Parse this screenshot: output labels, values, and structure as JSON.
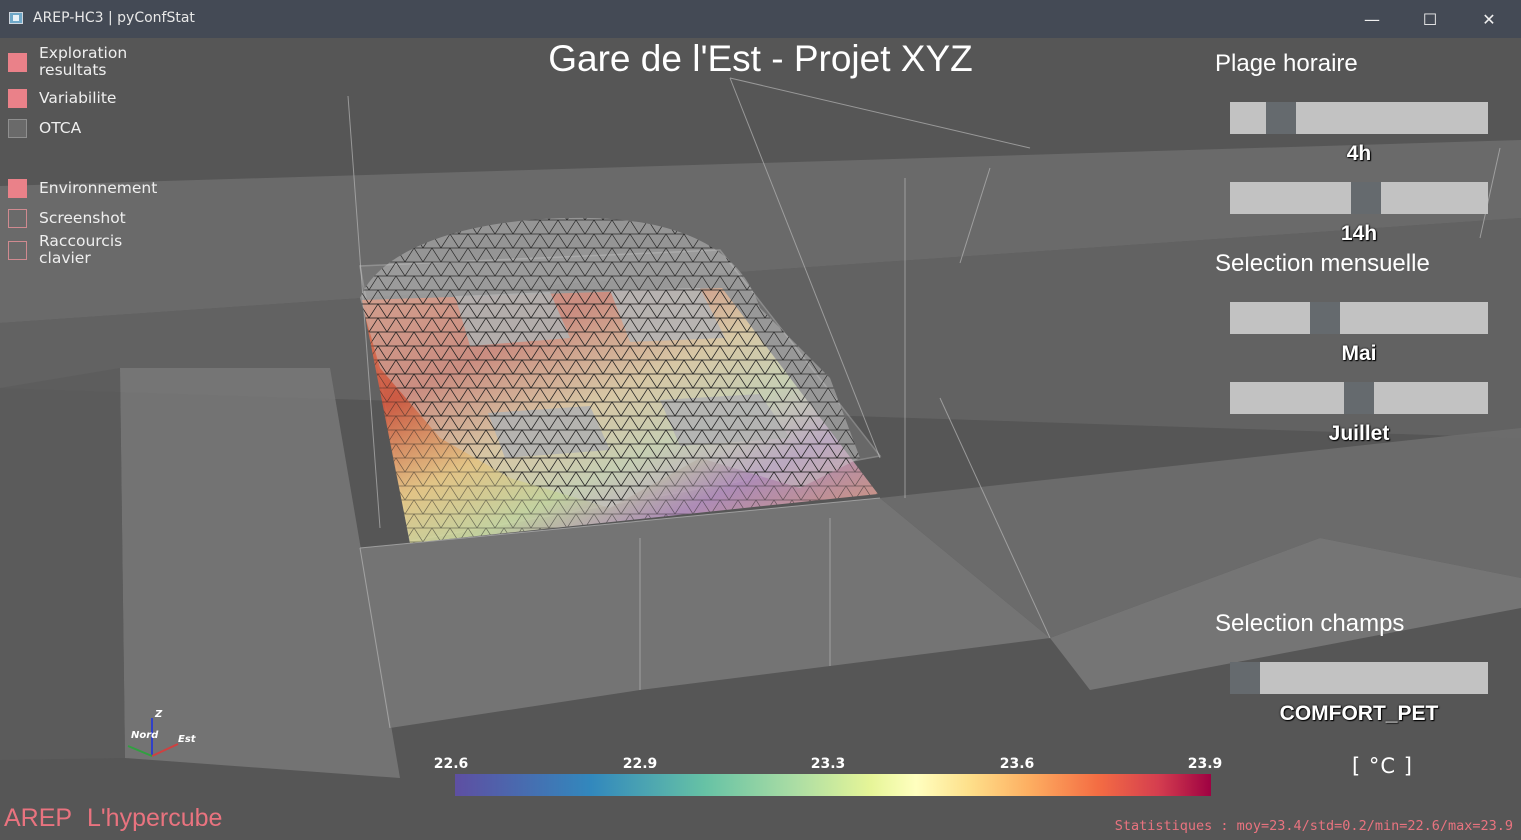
{
  "window": {
    "title": "AREP-HC3 | pyConfStat",
    "minimize": "—",
    "maximize": "☐",
    "close": "✕"
  },
  "scene_title": "Gare de l'Est - Projet XYZ",
  "menu": [
    {
      "label": "Exploration resultats",
      "state": "filled"
    },
    {
      "label": "Variabilite",
      "state": "filled"
    },
    {
      "label": "OTCA",
      "state": "gray"
    },
    {
      "label": "Environnement",
      "state": "filled"
    },
    {
      "label": "Screenshot",
      "state": "outline"
    },
    {
      "label": "Raccourcis clavier",
      "state": "outline"
    }
  ],
  "panel": {
    "plage_title": "Plage horaire",
    "mensuelle_title": "Selection mensuelle",
    "champs_title": "Selection champs",
    "sliders": [
      {
        "value_label": "4h",
        "position": 0.16
      },
      {
        "value_label": "14h",
        "position": 0.53
      },
      {
        "value_label": "Mai",
        "position": 0.35
      },
      {
        "value_label": "Juillet",
        "position": 0.5
      },
      {
        "value_label": "COMFORT_PET",
        "position": 0.0
      }
    ]
  },
  "axes": {
    "z": "Z",
    "nord": "Nord",
    "est": "Est"
  },
  "colorbar": {
    "ticks": [
      "22.6",
      "22.9",
      "23.3",
      "23.6",
      "23.9"
    ],
    "min": 22.6,
    "max": 23.9,
    "colors": [
      "#5e4fa2",
      "#3288bd",
      "#66c2a5",
      "#abdda4",
      "#e6f598",
      "#ffffbf",
      "#fee08b",
      "#fdae61",
      "#f46d43",
      "#d53e4f",
      "#9e0142"
    ],
    "unit": "[ °C ]"
  },
  "stats": "Statistiques : moy=23.4/std=0.2/min=22.6/max=23.9",
  "brand": {
    "arep": "AREP",
    "hypercube": "L'hypercube"
  },
  "accent_color": "#e9737f",
  "titlebar_color": "#444a55"
}
